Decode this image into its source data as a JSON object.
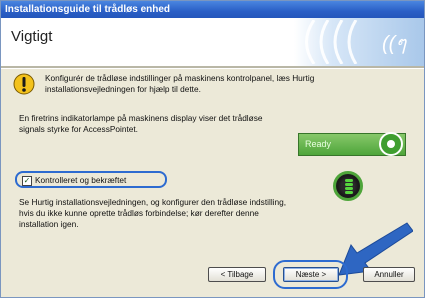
{
  "window": {
    "title": "Installationsguide til trådløs enhed"
  },
  "header": {
    "title": "Vigtigt",
    "logo_icon": "wifi-logo-icon"
  },
  "warning": {
    "icon": "warning-exclamation-icon",
    "text": "Konfigurér de trådløse indstillinger på maskinens kontrolpanel, læs Hurtig installationsvejledningen for hjælp til dette."
  },
  "body": {
    "paragraph1": "En firetrins indikatorlampe på maskinens display viser det trådløse signals styrke for AccessPointet.",
    "checkbox_label": "Kontrolleret og bekræftet",
    "checkbox_checked": true,
    "paragraph2": "Se Hurtig installationsvejledningen, og konfigurer den trådløse indstilling, hvis du ikke kunne oprette trådløs forbindelse; kør derefter denne installation igen."
  },
  "illustration": {
    "lcd_text": "Ready",
    "lcd_color": "#4ea53a",
    "led_icon": "wireless-led-icon",
    "arrow_icon": "pointer-arrow-icon",
    "arrow_color": "#2e66c2"
  },
  "buttons": {
    "back": "< Tilbage",
    "next": "Næste >",
    "cancel": "Annuller"
  },
  "colors": {
    "accent": "#2d6bd0",
    "titlebar": "#2a5fc6",
    "dialog_bg": "#ece9d8"
  }
}
